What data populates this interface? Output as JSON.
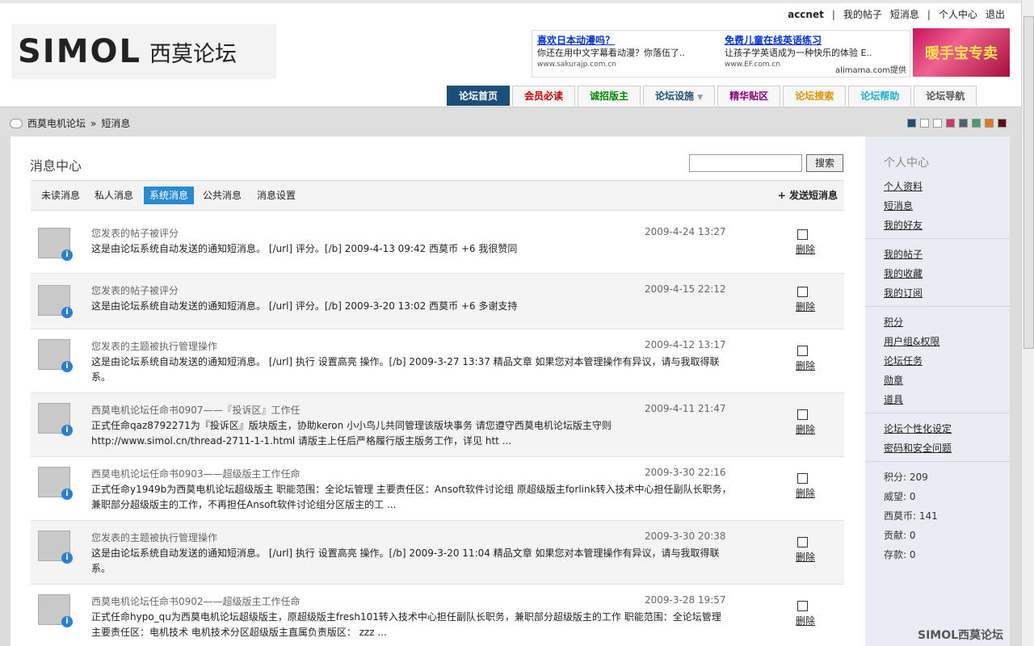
{
  "toplinks": {
    "user": "accnet",
    "posts": "我的帖子",
    "messages": "短消息",
    "center": "个人中心",
    "logout": "退出",
    "sep": "|"
  },
  "logo": {
    "brand": "SIMOL",
    "cn": "西莫论坛"
  },
  "ad": {
    "left": {
      "title": "喜欢日本动漫吗？",
      "text": "你还在用中文字幕看动漫？你落伍了..",
      "url": "www.sakurajp.com.cn"
    },
    "right": {
      "title": "免费儿童在线英语练习",
      "text": "让孩子学英语成为一种快乐的体验 E..",
      "url": "www.EF.com.cn"
    },
    "provider": "alimama.com提供",
    "banner": "暖手宝专卖"
  },
  "nav": [
    {
      "label": "论坛首页",
      "color": "#ffffff"
    },
    {
      "label": "会员必读",
      "color": "#cc0000"
    },
    {
      "label": "诚招版主",
      "color": "#008800"
    },
    {
      "label": "论坛设施",
      "color": "#1b4f7a"
    },
    {
      "label": "精华贴区",
      "color": "#8a0080"
    },
    {
      "label": "论坛搜索",
      "color": "#e09000"
    },
    {
      "label": "论坛帮助",
      "color": "#20b0d0"
    },
    {
      "label": "论坛导航",
      "color": "#555555"
    }
  ],
  "breadcrumb": {
    "home": "西莫电机论坛",
    "sep": "»",
    "current": "短消息"
  },
  "swatch_colors": [
    "#1b4f7a",
    "#ffffff",
    "#ffffff",
    "#c8386b",
    "#555f6e",
    "#4a9a6a",
    "#e07a1a",
    "#5a0d1a"
  ],
  "main": {
    "title": "消息中心",
    "search_button": "搜索",
    "tabs": [
      "未读消息",
      "私人消息",
      "系统消息",
      "公共消息",
      "消息设置"
    ],
    "send": "+ 发送短消息",
    "delete_label": "删除",
    "messages": [
      {
        "subject": "您发表的帖子被评分",
        "date": "2009-4-24 13:27",
        "body": "这是由论坛系统自动发送的通知短消息。 [/url] 评分。[/b] 2009-4-13 09:42 西莫币 +6 我很赞同"
      },
      {
        "subject": "您发表的帖子被评分",
        "date": "2009-4-15 22:12",
        "body": "这是由论坛系统自动发送的通知短消息。 [/url] 评分。[/b] 2009-3-20 13:02 西莫币 +6 多谢支持"
      },
      {
        "subject": "您发表的主题被执行管理操作",
        "date": "2009-4-12 13:17",
        "body": "这是由论坛系统自动发送的通知短消息。 [/url] 执行 设置高亮 操作。[/b] 2009-3-27 13:37 精品文章 如果您对本管理操作有异议，请与我取得联系。"
      },
      {
        "subject": "西莫电机论坛任命书0907——『投诉区』工作任",
        "date": "2009-4-11 21:47",
        "body": "正式任命qaz8792271为『投诉区』版块版主，协助keron 小小鸟儿共同管理该版块事务 请您遵守西莫电机论坛版主守则 http://www.simol.cn/thread-2711-1-1.html 请版主上任后严格履行版主版务工作，详见 htt ..."
      },
      {
        "subject": "西莫电机论坛任命书0903——超级版主工作任命",
        "date": "2009-3-30 22:16",
        "body": "正式任命y1949b为西莫电机论坛超级版主 职能范围：全论坛管理 主要责任区：Ansoft软件讨论组 原超级版主forlink转入技术中心担任副队长职务，兼职部分超级版主的工作，不再担任Ansoft软件讨论组分区版主的工 ..."
      },
      {
        "subject": "您发表的主题被执行管理操作",
        "date": "2009-3-30 20:38",
        "body": "这是由论坛系统自动发送的通知短消息。 [/url] 执行 设置高亮 操作。[/b] 2009-3-20 11:04 精品文章 如果您对本管理操作有异议，请与我取得联系。"
      },
      {
        "subject": "西莫电机论坛任命书0902——超级版主工作任命",
        "date": "2009-3-28 19:57",
        "body": "正式任命hypo_qu为西莫电机论坛超级版主，原超级版主fresh101转入技术中心担任副队长职务，兼职部分超级版主的工作 职能范围：全论坛管理 主要责任区：电机技术 电机技术分区超级版主直属负责版区： zzz ..."
      }
    ]
  },
  "side": {
    "title": "个人中心",
    "group1": [
      "个人资料",
      "短消息",
      "我的好友"
    ],
    "group2": [
      "我的帖子",
      "我的收藏",
      "我的订阅"
    ],
    "group3": [
      "积分",
      "用户组&权限",
      "论坛任务",
      "勋章",
      "道具"
    ],
    "group4": [
      "论坛个性化设定",
      "密码和安全问题"
    ],
    "stats": [
      "积分: 209",
      "威望: 0",
      "西莫币: 141",
      "贡献: 0",
      "存款: 0"
    ]
  },
  "footer_logo": "SIMOL西莫论坛"
}
